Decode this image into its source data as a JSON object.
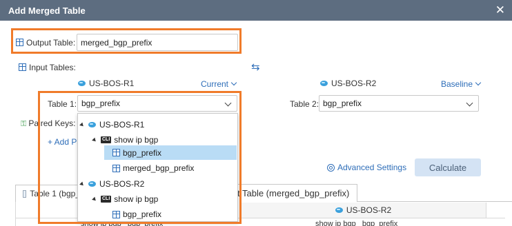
{
  "dialog": {
    "title": "Add Merged Table"
  },
  "output_table": {
    "label": "Output Table:",
    "value": "merged_bgp_prefix"
  },
  "input_tables": {
    "label": "Input Tables:"
  },
  "left_device": {
    "name": "US-BOS-R1",
    "mode": "Current",
    "table_label": "Table 1:",
    "table_value": "bgp_prefix"
  },
  "right_device": {
    "name": "US-BOS-R2",
    "mode": "Baseline",
    "table_label": "Table 2:",
    "table_value": "bgp_prefix"
  },
  "paired_keys": {
    "label": "Paired Keys:",
    "add_label": "+ Add Pa"
  },
  "dropdown": {
    "groups": [
      {
        "device": "US-BOS-R1",
        "command": "show ip bgp",
        "tables": [
          "bgp_prefix",
          "merged_bgp_prefix"
        ],
        "selected": "bgp_prefix"
      },
      {
        "device": "US-BOS-R2",
        "command": "show ip bgp",
        "tables": [
          "bgp_prefix"
        ]
      }
    ],
    "cli_badge": "CLI"
  },
  "advanced_settings": {
    "label": "Advanced Settings"
  },
  "calculate": {
    "label": "Calculate"
  },
  "tabs": [
    {
      "label": "Table 1 (bgp_"
    },
    {
      "label": "t Table (merged_bgp_prefix)"
    }
  ],
  "grid": {
    "header": "US-BOS-R2",
    "row_left": "show ip bgp   bgp_prefix",
    "row_right": "show ip bgp   bgp_prefix"
  },
  "colors": {
    "accent": "#f07b2a",
    "link": "#2d6db8",
    "titlebar": "#5d6d80",
    "selected": "#b9dcf5"
  }
}
